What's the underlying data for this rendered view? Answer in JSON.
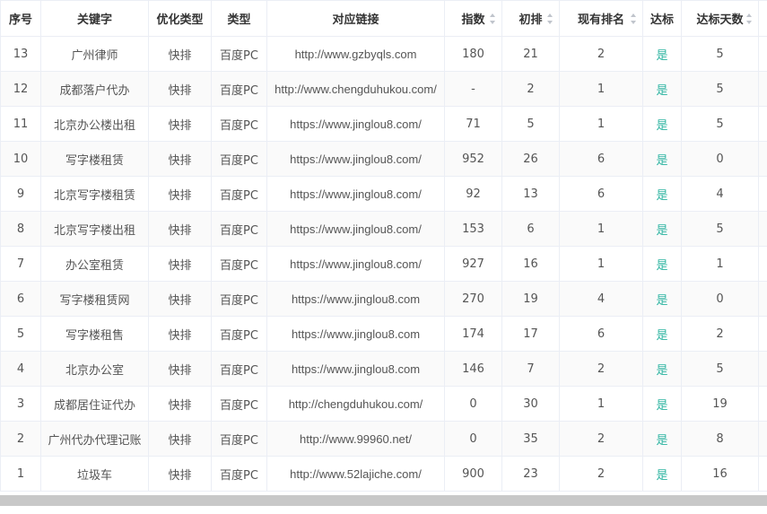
{
  "table": {
    "headers": {
      "index": "序号",
      "keyword": "关键字",
      "opt_type": "优化类型",
      "type": "类型",
      "url": "对应链接",
      "index_value": "指数",
      "initial_rank": "初排",
      "current_rank": "现有排名",
      "reached": "达标",
      "reached_days": "达标天数"
    },
    "rows": [
      {
        "index": "13",
        "keyword": "广州律师",
        "opt_type": "快排",
        "type": "百度PC",
        "url": "http://www.gzbyqls.com",
        "index_value": "180",
        "initial_rank": "21",
        "current_rank": "2",
        "reached": "是",
        "reached_days": "5"
      },
      {
        "index": "12",
        "keyword": "成都落户代办",
        "opt_type": "快排",
        "type": "百度PC",
        "url": "http://www.chengduhukou.com/",
        "index_value": "-",
        "initial_rank": "2",
        "current_rank": "1",
        "reached": "是",
        "reached_days": "5"
      },
      {
        "index": "11",
        "keyword": "北京办公楼出租",
        "opt_type": "快排",
        "type": "百度PC",
        "url": "https://www.jinglou8.com/",
        "index_value": "71",
        "initial_rank": "5",
        "current_rank": "1",
        "reached": "是",
        "reached_days": "5"
      },
      {
        "index": "10",
        "keyword": "写字楼租赁",
        "opt_type": "快排",
        "type": "百度PC",
        "url": "https://www.jinglou8.com/",
        "index_value": "952",
        "initial_rank": "26",
        "current_rank": "6",
        "reached": "是",
        "reached_days": "0"
      },
      {
        "index": "9",
        "keyword": "北京写字楼租赁",
        "opt_type": "快排",
        "type": "百度PC",
        "url": "https://www.jinglou8.com/",
        "index_value": "92",
        "initial_rank": "13",
        "current_rank": "6",
        "reached": "是",
        "reached_days": "4"
      },
      {
        "index": "8",
        "keyword": "北京写字楼出租",
        "opt_type": "快排",
        "type": "百度PC",
        "url": "https://www.jinglou8.com/",
        "index_value": "153",
        "initial_rank": "6",
        "current_rank": "1",
        "reached": "是",
        "reached_days": "5"
      },
      {
        "index": "7",
        "keyword": "办公室租赁",
        "opt_type": "快排",
        "type": "百度PC",
        "url": "https://www.jinglou8.com/",
        "index_value": "927",
        "initial_rank": "16",
        "current_rank": "1",
        "reached": "是",
        "reached_days": "1"
      },
      {
        "index": "6",
        "keyword": "写字楼租赁网",
        "opt_type": "快排",
        "type": "百度PC",
        "url": "https://www.jinglou8.com",
        "index_value": "270",
        "initial_rank": "19",
        "current_rank": "4",
        "reached": "是",
        "reached_days": "0"
      },
      {
        "index": "5",
        "keyword": "写字楼租售",
        "opt_type": "快排",
        "type": "百度PC",
        "url": "https://www.jinglou8.com",
        "index_value": "174",
        "initial_rank": "17",
        "current_rank": "6",
        "reached": "是",
        "reached_days": "2"
      },
      {
        "index": "4",
        "keyword": "北京办公室",
        "opt_type": "快排",
        "type": "百度PC",
        "url": "https://www.jinglou8.com",
        "index_value": "146",
        "initial_rank": "7",
        "current_rank": "2",
        "reached": "是",
        "reached_days": "5"
      },
      {
        "index": "3",
        "keyword": "成都居住证代办",
        "opt_type": "快排",
        "type": "百度PC",
        "url": "http://chengduhukou.com/",
        "index_value": "0",
        "initial_rank": "30",
        "current_rank": "1",
        "reached": "是",
        "reached_days": "19"
      },
      {
        "index": "2",
        "keyword": "广州代办代理记账",
        "opt_type": "快排",
        "type": "百度PC",
        "url": "http://www.99960.net/",
        "index_value": "0",
        "initial_rank": "35",
        "current_rank": "2",
        "reached": "是",
        "reached_days": "8"
      },
      {
        "index": "1",
        "keyword": "垃圾车",
        "opt_type": "快排",
        "type": "百度PC",
        "url": "http://www.52lajiche.com/",
        "index_value": "900",
        "initial_rank": "23",
        "current_rank": "2",
        "reached": "是",
        "reached_days": "16"
      }
    ]
  },
  "colors": {
    "reached_text": "#2bb3a0",
    "border": "#ebeef5",
    "scrollbar": "#c8c8c8"
  },
  "icons": {
    "sort": "sort-caret-icon"
  }
}
